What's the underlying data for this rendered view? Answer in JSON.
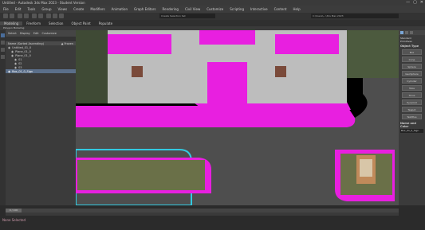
{
  "window": {
    "title": "Untitled - Autodesk 3ds Max 2023 - Student Version",
    "controls": [
      "—",
      "▢",
      "✕"
    ]
  },
  "menu": [
    "File",
    "Edit",
    "Tools",
    "Group",
    "Views",
    "Create",
    "Modifiers",
    "Animation",
    "Graph Editors",
    "Rendering",
    "Civil View",
    "Customize",
    "Scripting",
    "Interactive",
    "Content",
    "Help"
  ],
  "toolbar": {
    "selection_set_placeholder": "Create Selection Set",
    "sign_in": "Sign In",
    "workspace": "Workspaces:",
    "path": "C:\\Users\\...\\3ds Max 2023"
  },
  "ribbon": {
    "tabs": [
      "Modeling",
      "Freeform",
      "Selection",
      "Object Paint",
      "Populate"
    ],
    "sub": "Polygon Modeling"
  },
  "scene_explorer": {
    "tabs": [
      "Select",
      "Display",
      "Edit",
      "Customize"
    ],
    "header_name": "Name (Sorted Ascending)",
    "header_frozen": "▲ Frozen",
    "items": [
      {
        "label": "Untitled_01_0",
        "sel": false
      },
      {
        "label": "Plane_01_0",
        "sel": false
      },
      {
        "label": "Plane_01_0",
        "sel": false
      },
      {
        "label": "01",
        "sel": false
      },
      {
        "label": "02",
        "sel": false
      },
      {
        "label": "03",
        "sel": false
      },
      {
        "label": "Box_01_0_Sign",
        "sel": true
      }
    ]
  },
  "command_panel": {
    "object_type": "Object Type",
    "autogrid": "AutoGrid",
    "buttons": [
      "Box",
      "Cone",
      "Sphere",
      "GeoSphere",
      "Cylinder",
      "Tube",
      "Torus",
      "Pyramid",
      "Teapot",
      "TextPlus"
    ],
    "name_color": "Name and Color",
    "name_value": "Box_01_0_Sign",
    "category": "Standard Primitives"
  },
  "status": {
    "text": "0 / 100",
    "selected": "None Selected"
  }
}
